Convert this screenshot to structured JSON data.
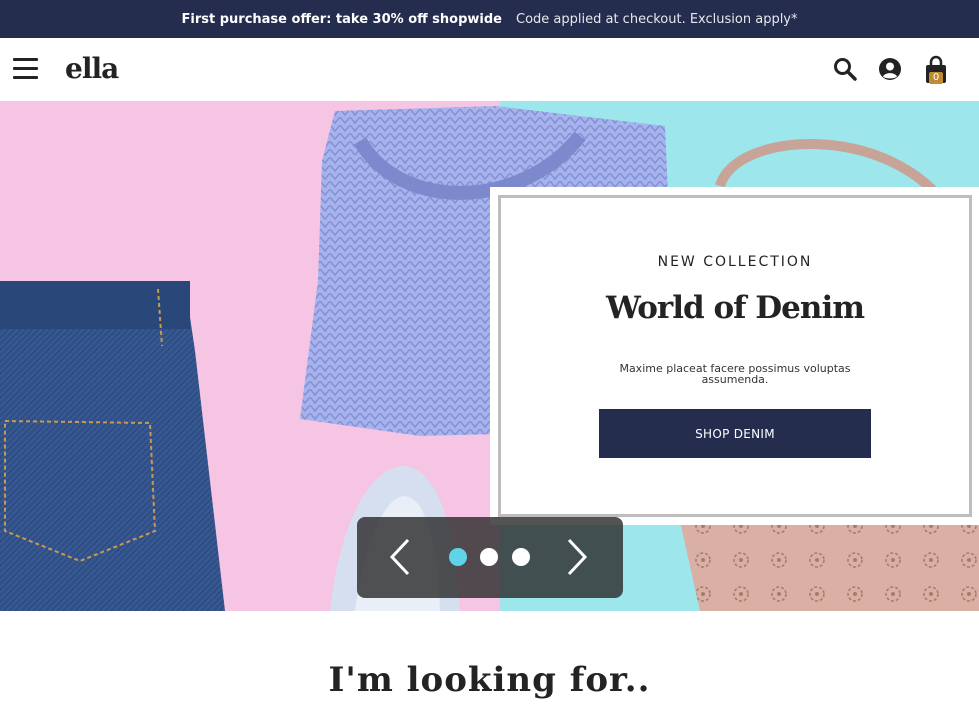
{
  "announcement": {
    "offer": "First purchase offer: take 30% off shopwide",
    "note": "Code applied at checkout. Exclusion apply*"
  },
  "header": {
    "logo": "ella",
    "icons": [
      "menu-icon",
      "search-icon",
      "account-icon",
      "cart-icon"
    ],
    "cart_count": "0"
  },
  "hero": {
    "subtitle": "NEW COLLECTION",
    "title": "World of Denim",
    "description": "Maxime placeat facere possimus voluptas assumenda.",
    "button": "SHOP DENIM",
    "slides_total": 3,
    "active_slide": 1
  },
  "section": {
    "title": "I'm looking for.."
  },
  "colors": {
    "navy": "#252d4f",
    "accent_dot": "#5fd3e7",
    "cart_badge": "#c28a35",
    "pink": "#f5c5e3",
    "aqua": "#9ce6ec"
  }
}
